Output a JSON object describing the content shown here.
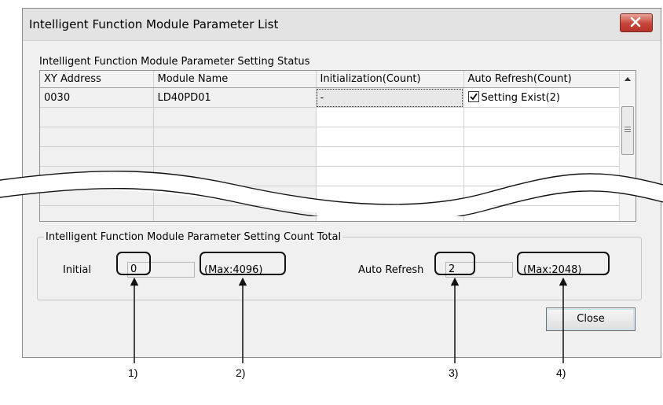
{
  "window": {
    "title": "Intelligent Function Module Parameter List"
  },
  "status_section": {
    "label": "Intelligent Function Module Parameter Setting Status"
  },
  "table": {
    "headers": [
      "XY Address",
      "Module Name",
      "Initialization(Count)",
      "Auto Refresh(Count)"
    ],
    "rows": [
      {
        "xy": "0030",
        "module": "LD40PD01",
        "init": "-",
        "auto_refresh": "Setting Exist(2)",
        "auto_checked": true
      }
    ]
  },
  "count_total": {
    "label": "Intelligent Function Module Parameter Setting Count Total",
    "initial_label": "Initial",
    "initial_value": "0",
    "initial_max": "(Max:4096)",
    "auto_label": "Auto Refresh",
    "auto_value": "2",
    "auto_max": "(Max:2048)"
  },
  "buttons": {
    "close": "Close"
  },
  "callouts": [
    "1)",
    "2)",
    "3)",
    "4)"
  ]
}
